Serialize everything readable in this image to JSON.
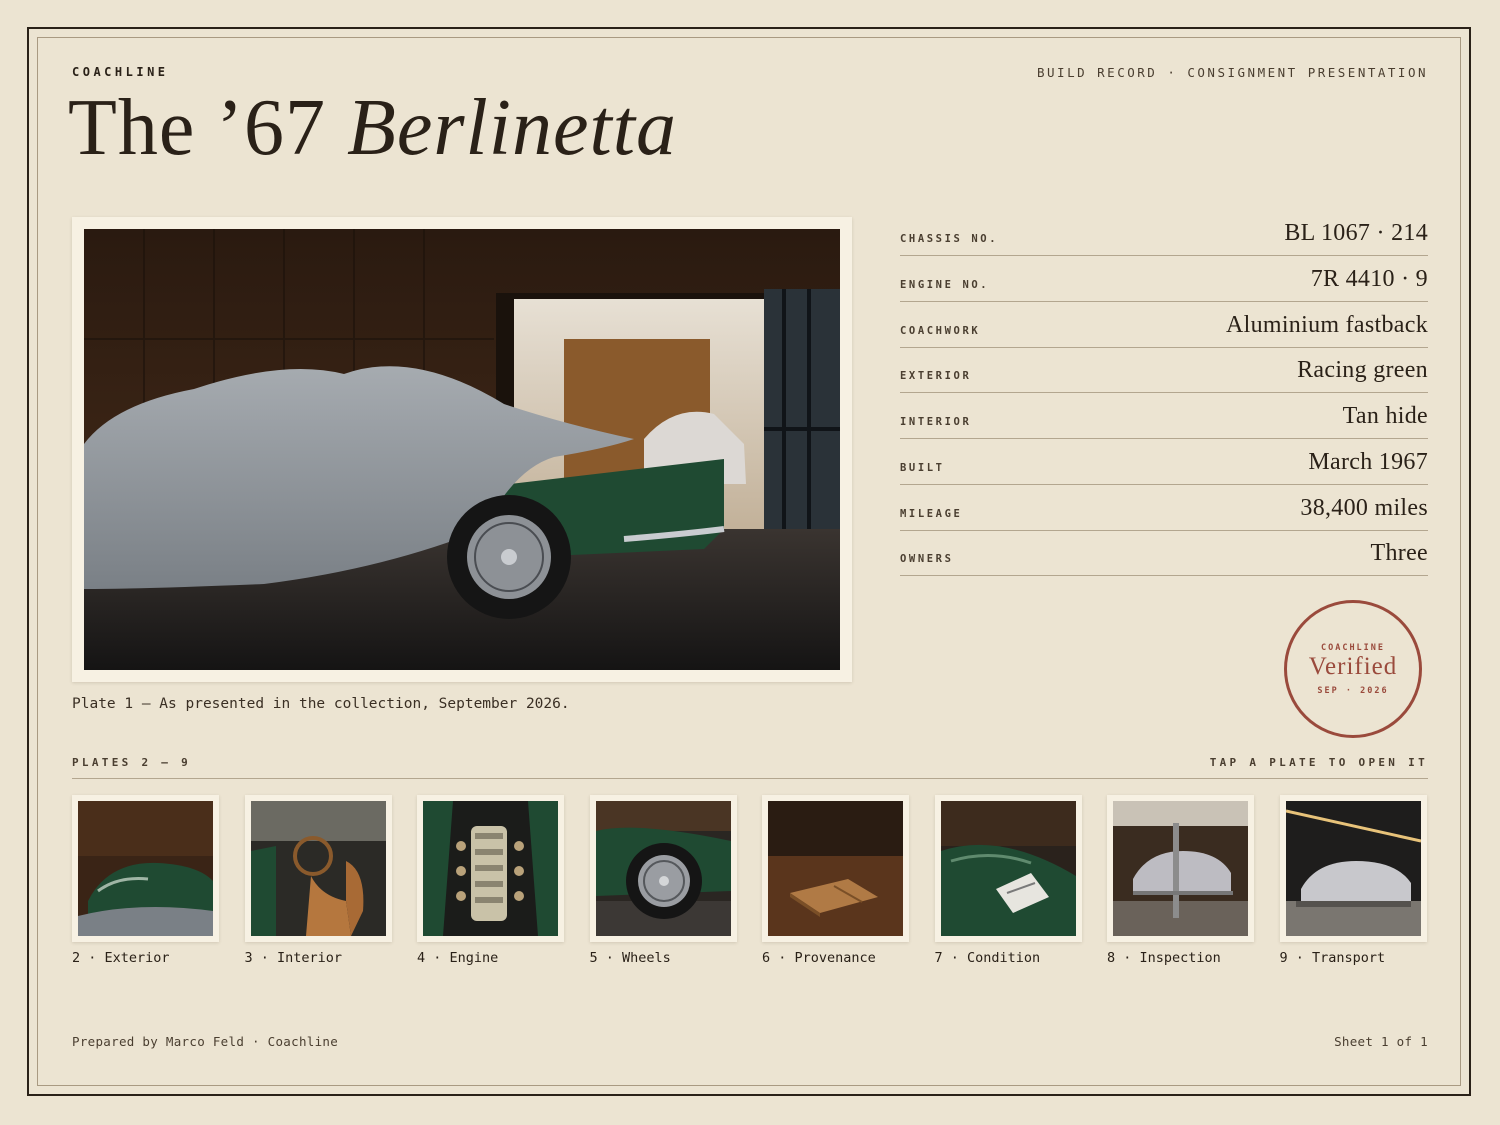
{
  "header": {
    "brand": "COACHLINE",
    "doc_type": "BUILD RECORD · CONSIGNMENT PRESENTATION",
    "title_plain": "The ’67 ",
    "title_italic": "Berlinetta"
  },
  "hero": {
    "image_icon": "covered-car-photo",
    "caption": "Plate 1 — As presented in the collection, September 2026."
  },
  "specs": [
    {
      "label": "CHASSIS NO.",
      "value": "BL 1067 · 214"
    },
    {
      "label": "ENGINE NO.",
      "value": "7R 4410 · 9"
    },
    {
      "label": "COACHWORK",
      "value": "Aluminium fastback"
    },
    {
      "label": "EXTERIOR",
      "value": "Racing green"
    },
    {
      "label": "INTERIOR",
      "value": "Tan hide"
    },
    {
      "label": "BUILT",
      "value": "March 1967"
    },
    {
      "label": "MILEAGE",
      "value": "38,400 miles"
    },
    {
      "label": "OWNERS",
      "value": "Three"
    }
  ],
  "stamp": {
    "top": "COACHLINE",
    "main": "Verified",
    "bottom": "SEP · 2026",
    "color": "#9a4a3c"
  },
  "plates": {
    "heading_left": "PLATES 2 – 9",
    "heading_right": "TAP A PLATE TO OPEN IT",
    "items": [
      {
        "label": "2 · Exterior",
        "icon": "exterior-photo"
      },
      {
        "label": "3 · Interior",
        "icon": "interior-photo"
      },
      {
        "label": "4 · Engine",
        "icon": "engine-photo"
      },
      {
        "label": "5 · Wheels",
        "icon": "wheel-photo"
      },
      {
        "label": "6 · Provenance",
        "icon": "leather-folio-photo"
      },
      {
        "label": "7 · Condition",
        "icon": "condition-photo"
      },
      {
        "label": "8 · Inspection",
        "icon": "lift-photo"
      },
      {
        "label": "9 · Transport",
        "icon": "transport-photo"
      }
    ]
  },
  "footer": {
    "prepared_by": "Prepared by Marco Feld · Coachline",
    "sheet": "Sheet 1 of 1"
  },
  "colors": {
    "paper": "#ece4d2",
    "ink": "#2a2118",
    "racing_green": "#1f4a32",
    "stamp_red": "#9a4a3c"
  }
}
